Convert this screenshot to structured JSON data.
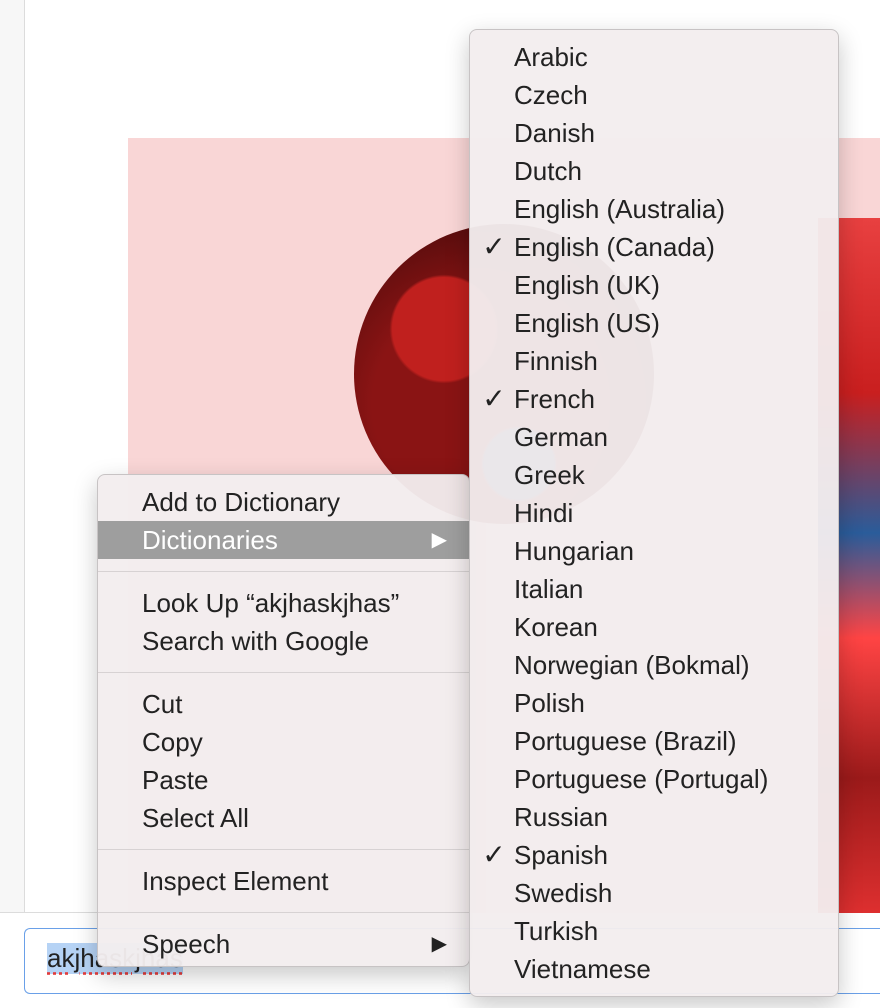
{
  "input": {
    "value": "akjhaskjhas"
  },
  "context_menu": {
    "add_to_dictionary": "Add to Dictionary",
    "dictionaries": "Dictionaries",
    "look_up": "Look Up “akjhaskjhas”",
    "search_with_google": "Search with Google",
    "cut": "Cut",
    "copy": "Copy",
    "paste": "Paste",
    "select_all": "Select All",
    "inspect_element": "Inspect Element",
    "speech": "Speech",
    "submenu_arrow": "▶"
  },
  "dictionaries_menu": {
    "check_glyph": "✓",
    "items": [
      {
        "label": "Arabic",
        "checked": false
      },
      {
        "label": "Czech",
        "checked": false
      },
      {
        "label": "Danish",
        "checked": false
      },
      {
        "label": "Dutch",
        "checked": false
      },
      {
        "label": "English (Australia)",
        "checked": false
      },
      {
        "label": "English (Canada)",
        "checked": true
      },
      {
        "label": "English (UK)",
        "checked": false
      },
      {
        "label": "English (US)",
        "checked": false
      },
      {
        "label": "Finnish",
        "checked": false
      },
      {
        "label": "French",
        "checked": true
      },
      {
        "label": "German",
        "checked": false
      },
      {
        "label": "Greek",
        "checked": false
      },
      {
        "label": "Hindi",
        "checked": false
      },
      {
        "label": "Hungarian",
        "checked": false
      },
      {
        "label": "Italian",
        "checked": false
      },
      {
        "label": "Korean",
        "checked": false
      },
      {
        "label": "Norwegian (Bokmal)",
        "checked": false
      },
      {
        "label": "Polish",
        "checked": false
      },
      {
        "label": "Portuguese (Brazil)",
        "checked": false
      },
      {
        "label": "Portuguese (Portugal)",
        "checked": false
      },
      {
        "label": "Russian",
        "checked": false
      },
      {
        "label": "Spanish",
        "checked": true
      },
      {
        "label": "Swedish",
        "checked": false
      },
      {
        "label": "Turkish",
        "checked": false
      },
      {
        "label": "Vietnamese",
        "checked": false
      }
    ]
  },
  "colors": {
    "menu_highlight": "#9e9e9e",
    "hero_background": "#f9d6d6",
    "input_focus_border": "#6aa0e8",
    "text_selection": "#b6d3f5"
  }
}
